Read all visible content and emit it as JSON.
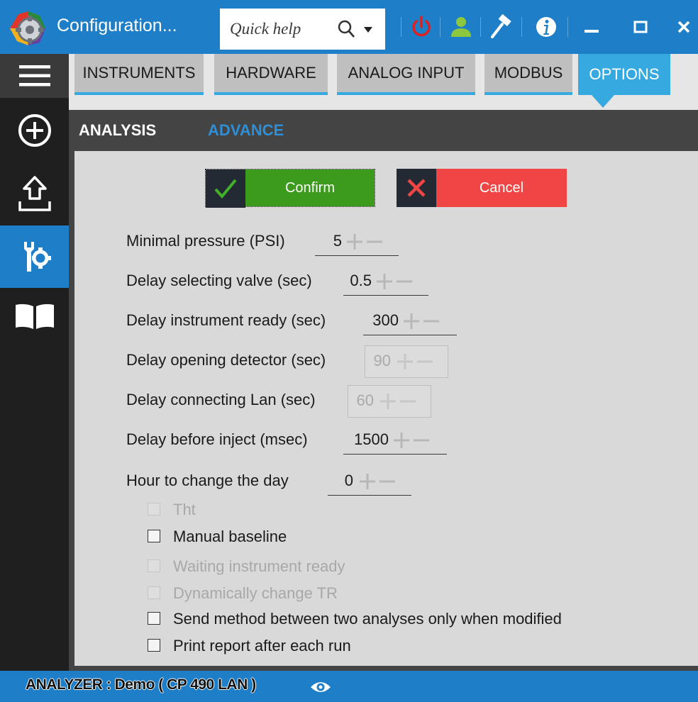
{
  "window": {
    "title": "Configuration...",
    "quick_help_label": "Quick help"
  },
  "tabs": [
    {
      "label": "INSTRUMENTS",
      "active": false
    },
    {
      "label": "HARDWARE",
      "active": false
    },
    {
      "label": "ANALOG INPUT",
      "active": false
    },
    {
      "label": "MODBUS",
      "active": false
    },
    {
      "label": "OPTIONS",
      "active": true
    }
  ],
  "subtabs": {
    "analysis": "ANALYSIS",
    "advance": "ADVANCE"
  },
  "actions": {
    "confirm_label": "Confirm",
    "cancel_label": "Cancel"
  },
  "settings": [
    {
      "label": "Minimal pressure (PSI)",
      "value": "5",
      "enabled": true
    },
    {
      "label": "Delay selecting valve (sec)",
      "value": "0.5",
      "enabled": true
    },
    {
      "label": "Delay instrument ready (sec)",
      "value": "300",
      "enabled": true
    },
    {
      "label": "Delay opening detector (sec)",
      "value": "90",
      "enabled": false
    },
    {
      "label": "Delay connecting Lan (sec)",
      "value": "60",
      "enabled": false
    },
    {
      "label": "Delay before inject (msec)",
      "value": "1500",
      "enabled": true
    },
    {
      "label": "Hour to change the day",
      "value": "0",
      "enabled": true
    }
  ],
  "checkboxes": [
    {
      "label": "Tht",
      "checked": false,
      "enabled": false
    },
    {
      "label": "Manual baseline",
      "checked": false,
      "enabled": true
    },
    {
      "label": "Waiting instrument ready",
      "checked": false,
      "enabled": false
    },
    {
      "label": "Dynamically change TR",
      "checked": false,
      "enabled": false
    },
    {
      "label": "Send method between two analyses only when modified",
      "checked": false,
      "enabled": true
    },
    {
      "label": "Print report after each run",
      "checked": false,
      "enabled": true
    }
  ],
  "status": {
    "text": "ANALYZER :  Demo ( CP 490 LAN )"
  },
  "colors": {
    "accent": "#1e7fc8",
    "tab_active": "#35a9e0",
    "confirm": "#3c9a1c",
    "cancel": "#f04545",
    "power": "#e02020",
    "user": "#8dc63f"
  },
  "icons": {
    "titlebar": [
      "app-gear-icon",
      "search-icon",
      "caret-down-icon",
      "power-icon",
      "user-icon",
      "hammer-icon",
      "info-icon",
      "minimize-icon",
      "maximize-icon",
      "close-icon"
    ],
    "sidebar": [
      "hamburger-menu-icon",
      "add-circle-icon",
      "upload-icon",
      "config-wrench-gear-icon",
      "book-icon"
    ],
    "status": [
      "eye-icon"
    ]
  }
}
